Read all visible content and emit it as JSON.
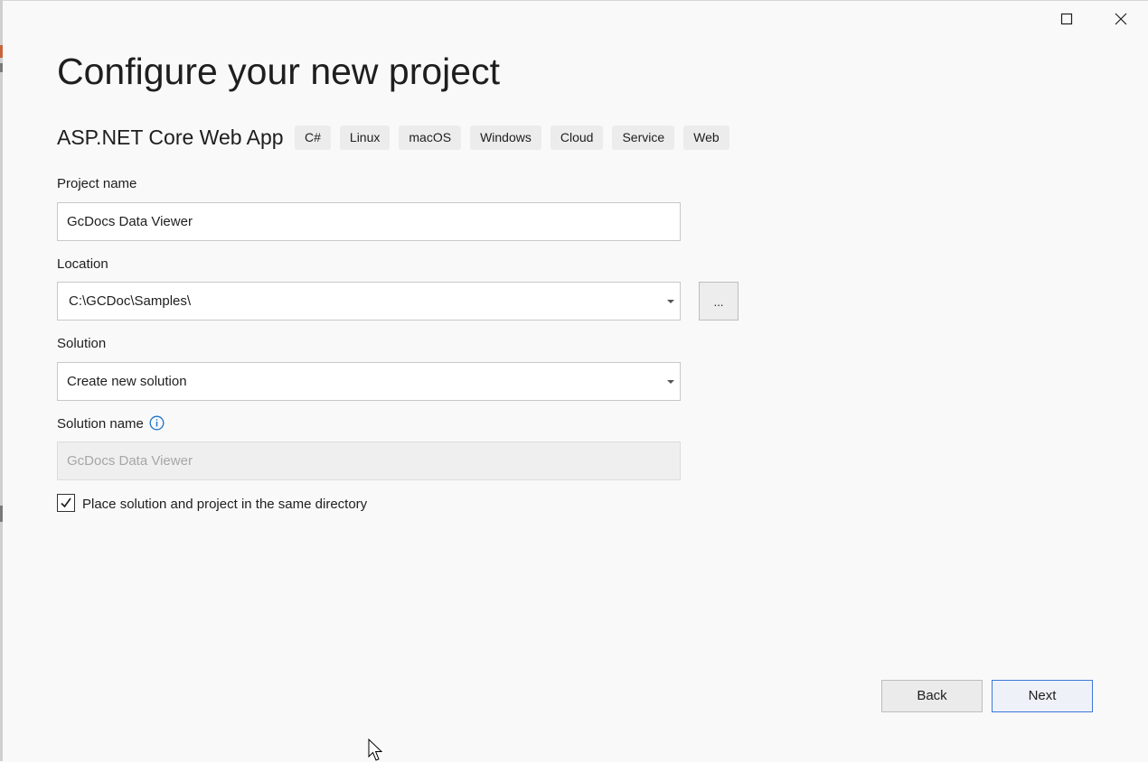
{
  "window": {
    "maximize_icon": "maximize-icon",
    "close_icon": "close-icon"
  },
  "page": {
    "title": "Configure your new project"
  },
  "template": {
    "name": "ASP.NET Core Web App",
    "tags": [
      "C#",
      "Linux",
      "macOS",
      "Windows",
      "Cloud",
      "Service",
      "Web"
    ]
  },
  "form": {
    "project_name_label": "Project name",
    "project_name_value": "GcDocs Data Viewer",
    "location_label": "Location",
    "location_value": "C:\\GCDoc\\Samples\\",
    "browse_label": "...",
    "solution_label": "Solution",
    "solution_value": "Create new solution",
    "solution_name_label": "Solution name",
    "solution_name_value": "GcDocs Data Viewer",
    "same_directory_label": "Place solution and project in the same directory",
    "same_directory_checked": true
  },
  "buttons": {
    "back": "Back",
    "next": "Next"
  },
  "colors": {
    "accent": "#3c78d8",
    "info": "#1a73c9"
  }
}
